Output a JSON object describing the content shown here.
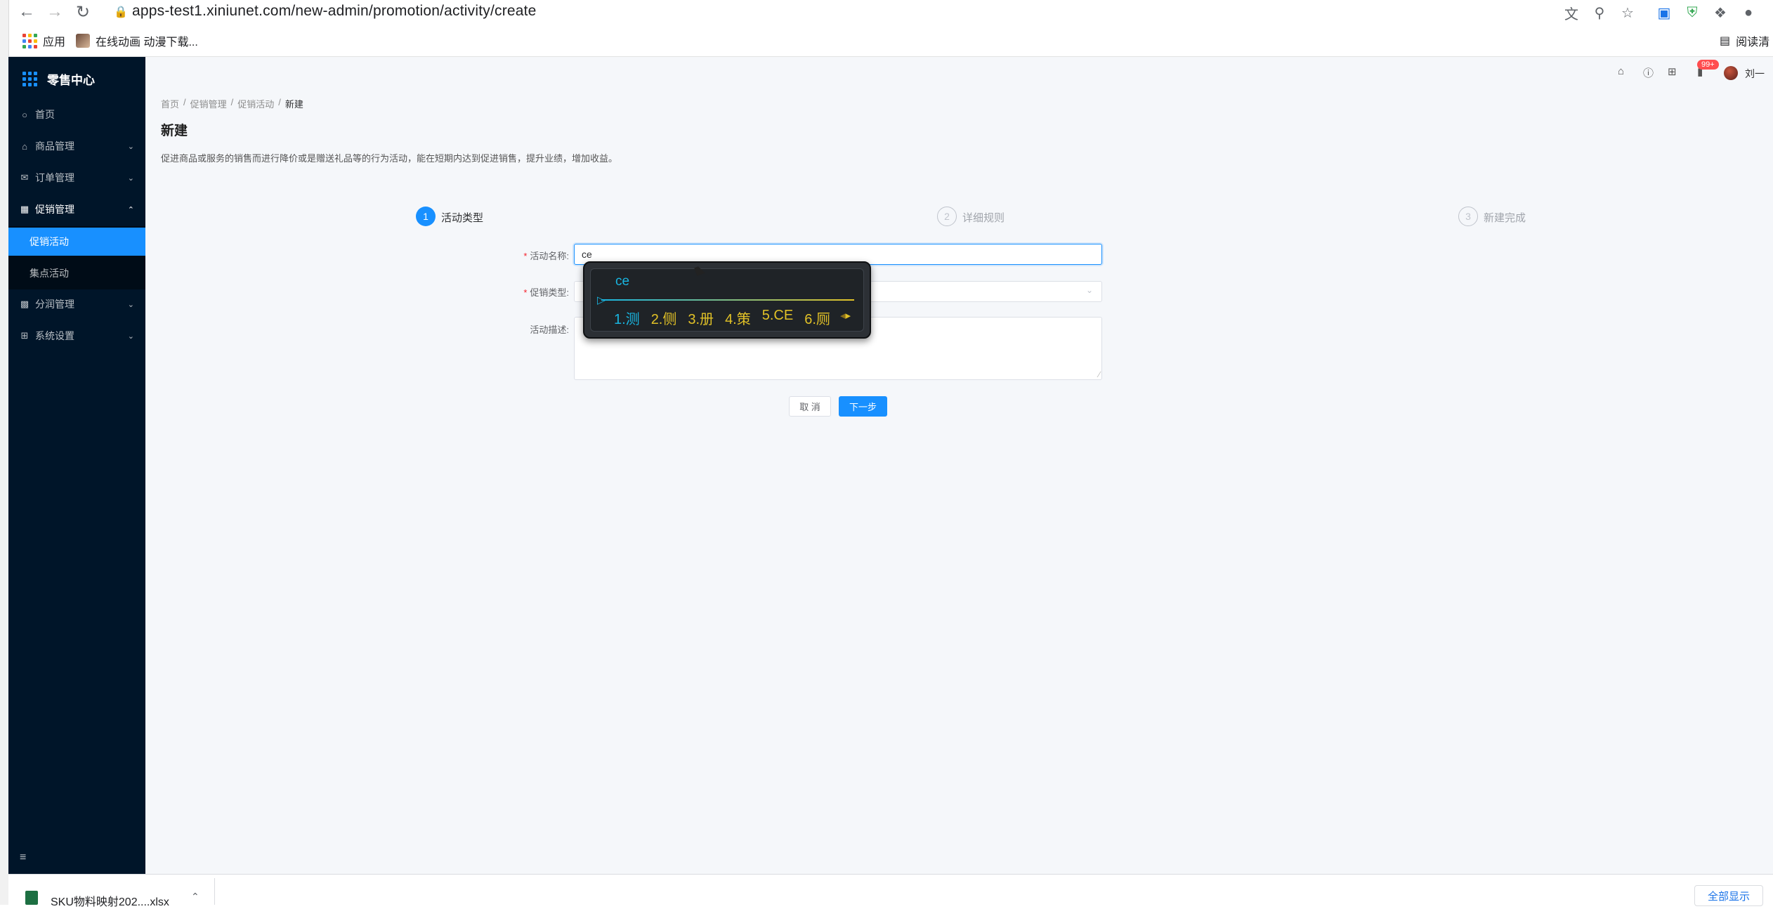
{
  "browser": {
    "url": "apps-test1.xiniunet.com/new-admin/promotion/activity/create",
    "icons": [
      "back-icon",
      "forward-icon",
      "reload-icon",
      "lock-icon",
      "translate-icon",
      "zoom-icon",
      "star-icon",
      "extension-icon",
      "shield-icon",
      "puzzle-icon",
      "profile-icon"
    ],
    "bookmarks": {
      "apps": "应用",
      "item1": "在线动画 动漫下载...",
      "reading_list": "阅读清"
    }
  },
  "sidebar": {
    "brand": "零售中心",
    "items": [
      {
        "label": "首页",
        "icon": "home-circle-icon"
      },
      {
        "label": "商品管理",
        "icon": "home-icon"
      },
      {
        "label": "订单管理",
        "icon": "mail-icon"
      },
      {
        "label": "促销管理",
        "icon": "calendar-icon"
      },
      {
        "label": "分润管理",
        "icon": "share-icon"
      },
      {
        "label": "系统设置",
        "icon": "grid-icon"
      }
    ],
    "submenu": [
      {
        "label": "促销活动",
        "active": true
      },
      {
        "label": "集点活动",
        "active": false
      }
    ]
  },
  "header": {
    "badge": "99+",
    "user": "刘一",
    "icons": [
      "home-icon",
      "help-icon",
      "apps-icon",
      "bell-icon"
    ]
  },
  "breadcrumb": [
    "首页",
    "促销管理",
    "促销活动",
    "新建"
  ],
  "page": {
    "title": "新建",
    "description": "促进商品或服务的销售而进行降价或是赠送礼品等的行为活动，能在短期内达到促进销售，提升业绩，增加收益。"
  },
  "steps": [
    {
      "num": "1",
      "label": "活动类型",
      "status": "active"
    },
    {
      "num": "2",
      "label": "详细规则",
      "status": "wait"
    },
    {
      "num": "3",
      "label": "新建完成",
      "status": "wait"
    }
  ],
  "form": {
    "name_label": "活动名称:",
    "name_value": "ce",
    "type_label": "促销类型:",
    "desc_label": "活动描述:",
    "cancel": "取 消",
    "next": "下一步"
  },
  "ime": {
    "pinyin": "ce",
    "candidates": [
      "1.测",
      "2.侧",
      "3.册",
      "4.策",
      "5.CE",
      "6.厕"
    ]
  },
  "downloads": {
    "file": "SKU物料映射202....xlsx",
    "show_all": "全部显示"
  }
}
